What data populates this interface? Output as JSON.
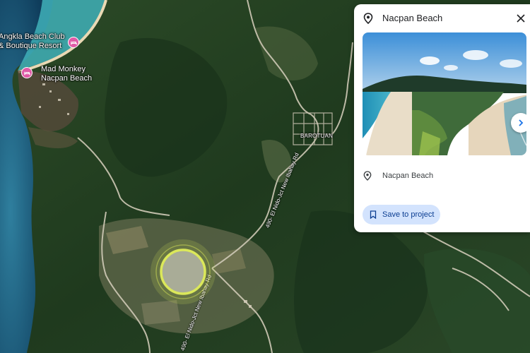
{
  "map": {
    "places": [
      {
        "id": "resort",
        "lines": [
          "Angkla Beach Club",
          "& Boutique Resort"
        ]
      },
      {
        "id": "monkey",
        "lines": [
          "Mad Monkey",
          "Nacpan Beach"
        ]
      },
      {
        "id": "town",
        "lines": [
          "BAROTUAN"
        ]
      }
    ],
    "roads": [
      {
        "id": "road-north",
        "text": "490- El Nido-Jct New Ibahay Rd"
      },
      {
        "id": "road-south",
        "text": "490- El Nido-Jct New Ibahay Rd"
      }
    ],
    "poi_icons": [
      "hotel-icon",
      "hotel-icon"
    ],
    "marker_color": "#d4e157"
  },
  "panel": {
    "title": "Nacpan Beach",
    "address": "Nacpan Beach",
    "save_label": "Save to project",
    "accent": "#d3e3fd"
  }
}
